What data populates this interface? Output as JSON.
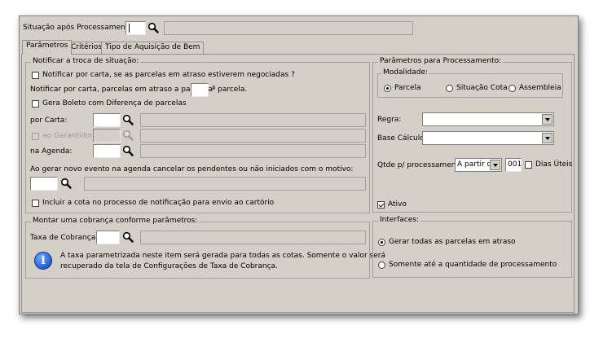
{
  "header": {
    "situacao_label": "Situação após Processamento:",
    "situacao_code": "",
    "situacao_desc": ""
  },
  "tabs": [
    {
      "label": "Parâmetros",
      "active": true
    },
    {
      "label": "Critérios",
      "active": false
    },
    {
      "label": "Tipo de Aquisição de Bem",
      "active": false
    }
  ],
  "notificar": {
    "legend": "Notificar a troca de situação:",
    "negociadas_label": "Notificar por carta, se as parcelas em atraso estiverem negociadas ?",
    "negociadas_checked": false,
    "atraso_prefix": "Notificar por carta, parcelas em atraso a partir da",
    "atraso_value": "",
    "atraso_suffix": "ª parcela.",
    "boleto_label": "Gera Boleto com Diferença de parcelas",
    "boleto_checked": false,
    "por_carta_label": "por Carta:",
    "garantidor_label": "ao Garantidor:",
    "agenda_label": "na Agenda:",
    "cancelar_label": "Ao gerar novo evento na agenda cancelar os pendentes ou não iniciados com o motivo:",
    "incluir_label": "Incluir a cota no processo de notificação para envio ao cartório",
    "incluir_checked": false
  },
  "cobranca": {
    "legend": "Montar uma cobrança conforme parâmetros:",
    "taxa_label": "Taxa de Cobrança:",
    "info_text_1": "A taxa parametrizada neste item será gerada para todas as cotas. Somente o valor será",
    "info_text_2": "recuperado da tela de Configurações de Taxa de Cobrança."
  },
  "processamento": {
    "legend": "Parâmetros para Processamento:",
    "modalidade_legend": "Modalidade:",
    "modalidades": [
      {
        "label": "Parcela",
        "selected": true
      },
      {
        "label": "Situação Cota",
        "selected": false
      },
      {
        "label": "Assembleia",
        "selected": false
      }
    ],
    "regra_label": "Regra:",
    "regra_value": "",
    "base_label": "Base Cálculo:",
    "base_value": "",
    "qtde_label": "Qtde p/ processamento:",
    "qtde_select": "A partir de",
    "qtde_value": "001",
    "dias_uteis_label": "Dias Úteis",
    "dias_uteis_checked": false,
    "ativo_label": "Ativo",
    "ativo_checked": true
  },
  "interfaces": {
    "legend": "Interfaces:",
    "options": [
      {
        "label": "Gerar todas as parcelas em atraso",
        "selected": true
      },
      {
        "label": "Somente até a quantidade de processamento",
        "selected": false
      }
    ]
  },
  "colors": {
    "window_bg": "#d4d0c8",
    "info_blue": "#0a3fb5"
  }
}
